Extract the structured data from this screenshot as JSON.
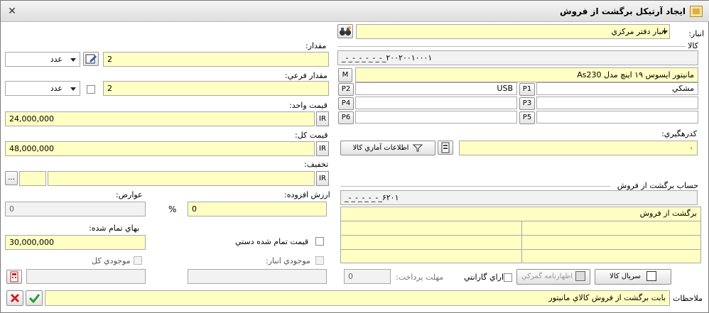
{
  "window": {
    "title": "ايجاد آرتيکل برگشت از فروش"
  },
  "warehouse": {
    "label": "انبار:",
    "value": "انبار دفتر مرکزي"
  },
  "goods": {
    "group_label": "کالا",
    "code": "_-_-_-_-_-_-_۲۰۰۲۰۰۱۰۰۰۱",
    "name": "مانيتور ايسوس ١٩ اينچ مدل As230",
    "m_button": "M",
    "props": {
      "p1_label": "P1",
      "p1_value": "مشکي",
      "p2_label": "P2",
      "p2_value": "USB",
      "p3_label": "P3",
      "p3_value": "",
      "p4_label": "P4",
      "p4_value": "",
      "p5_label": "P5",
      "p5_value": "",
      "p6_label": "P6",
      "p6_value": ""
    },
    "tracking_label": "کدرهگيري:",
    "tracking_value": "۰",
    "stats_button": "اطلاعات آماري کالا"
  },
  "qty": {
    "label": "مقدار:",
    "value": "2",
    "unit": "عدد"
  },
  "subqty": {
    "label": "مقدار فرعي:",
    "value": "2",
    "unit": "عدد"
  },
  "unit_price": {
    "label": "قيمت واحد:",
    "value": "24,000,000",
    "currency": "IR"
  },
  "total_price": {
    "label": "قيمت کل:",
    "value": "48,000,000",
    "currency": "IR"
  },
  "discount": {
    "label": "تخفيف:",
    "value": "",
    "currency": "IR",
    "more": "..."
  },
  "vat": {
    "label": "ارزش افزوده:",
    "value": "0",
    "percent": "%"
  },
  "duties": {
    "label": "عوارض:",
    "value": "0"
  },
  "final_cost": {
    "label": "بهاي تمام شده:",
    "value": "30,000,000"
  },
  "manual_cost": {
    "label": "قيمت تمام شده دستي"
  },
  "stock_warehouse": {
    "label": "موجودي انبار:"
  },
  "stock_total": {
    "label": "موجودي کل"
  },
  "return_account": {
    "label": "حساب برگشت از فروش",
    "code": "_-_-_-_-_-_۶۲۰۱",
    "rows": [
      [
        "برگشت از فروش",
        ""
      ],
      [
        "",
        ""
      ],
      [
        "",
        ""
      ],
      [
        "",
        ""
      ]
    ]
  },
  "serial_button": "سريال کالا",
  "customs_button": "اظهارنامه گمرکي",
  "warranty": {
    "label": "داراي گارانتي"
  },
  "payment_term": {
    "label": "مهلت پرداخت:",
    "value": "0"
  },
  "notes": {
    "label": "ملاحظات",
    "value": "بابت برگشت از فروش کالاي مانيتور"
  }
}
